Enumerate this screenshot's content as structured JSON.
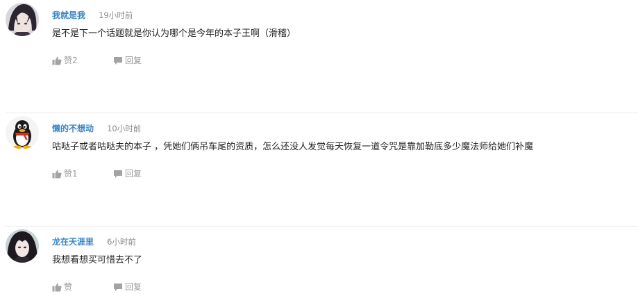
{
  "comments": [
    {
      "username": "我就是我",
      "time": "19小时前",
      "text": "是不是下一个话题就是你认为哪个是今年的本子王啊（滑稽）",
      "like_label": "赞2",
      "reply_label": "回复",
      "avatar": "dark-haired-anime-avatar"
    },
    {
      "username": "懒的不想动",
      "time": "10小时前",
      "text": "咕哒子或者咕哒夫的本子 ，凭她们俩吊车尾的资质，怎么还没人发觉每天恢复一道令咒是靠加勒底多少魔法师给她们补魔",
      "like_label": "赞1",
      "reply_label": "回复",
      "avatar": "qq-penguin-avatar"
    },
    {
      "username": "龙在天涯里",
      "time": "6小时前",
      "text": "我想看想买可惜去不了",
      "like_label": "赞",
      "reply_label": "回复",
      "avatar": "long-haired-anime-avatar"
    }
  ],
  "colors": {
    "username": "#3a86c8",
    "meta_gray": "#8a8a8a",
    "text": "#222222",
    "divider": "#e8e8e8"
  }
}
